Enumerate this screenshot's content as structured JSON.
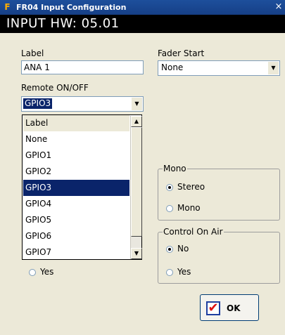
{
  "window": {
    "title": "FR04 Input Configuration",
    "icon_letter": "F",
    "close_glyph": "×"
  },
  "header": {
    "text": "INPUT HW: 05.01"
  },
  "label_field": {
    "label": "Label",
    "value": "ANA 1"
  },
  "fader_start": {
    "label": "Fader Start",
    "value": "None"
  },
  "remote": {
    "label": "Remote ON/OFF",
    "value": "GPIO3",
    "options": [
      "Label",
      "None",
      "GPIO1",
      "GPIO2",
      "GPIO3",
      "GPIO4",
      "GPIO5",
      "GPIO6",
      "GPIO7"
    ],
    "selected_index": 4
  },
  "mono_group": {
    "title": "Mono",
    "options": [
      "Stereo",
      "Mono"
    ],
    "selected": "Stereo"
  },
  "control_on_air": {
    "title": "Control On Air",
    "options": [
      "No",
      "Yes"
    ],
    "selected": "No"
  },
  "left_partial": {
    "yes_label": "Yes"
  },
  "ok_button": {
    "label": "OK"
  },
  "colors": {
    "title_bar": "#163f86",
    "selection": "#0a246a",
    "dialog_bg": "#ece9d8"
  },
  "icons": {
    "arrow_down": "▼",
    "arrow_up": "▲",
    "check": "✔"
  }
}
